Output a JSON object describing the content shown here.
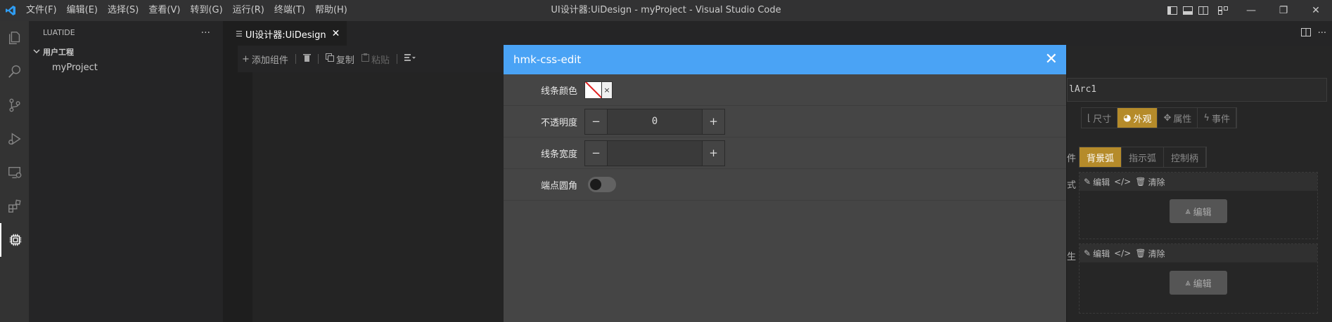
{
  "window": {
    "title": "UI设计器:UiDesign - myProject - Visual Studio Code",
    "menu": [
      "文件(F)",
      "编辑(E)",
      "选择(S)",
      "查看(V)",
      "转到(G)",
      "运行(R)",
      "终端(T)",
      "帮助(H)"
    ],
    "minimize": "—",
    "maximize": "❐",
    "close": "✕"
  },
  "sidebar": {
    "title": "LUATIDE",
    "more": "···",
    "section": "用户工程",
    "items": [
      {
        "label": "myProject"
      }
    ]
  },
  "editor": {
    "tab_label": "UI设计器:UiDesign",
    "tab_close": "✕",
    "more": "···"
  },
  "toolbar": {
    "add_label": "添加组件",
    "copy_label": "复制",
    "paste_label": "粘贴"
  },
  "modal": {
    "title": "hmk-css-edit",
    "close": "✕",
    "rows": {
      "line_color": "线条颜色",
      "opacity": "不透明度",
      "opacity_value": "0",
      "line_width": "线条宽度",
      "line_width_value": "",
      "round_ends": "端点圆角"
    },
    "round_ends_on": false,
    "swatch_clear": "×",
    "minus": "−",
    "plus": "+"
  },
  "right_panel": {
    "name_value": "lArc1",
    "tabs": [
      "尺寸",
      "外观",
      "属性",
      "事件"
    ],
    "active_tab": "外观",
    "side_label_1": "件",
    "side_label_2": "式",
    "side_label_3": "生",
    "subtabs": [
      "背景弧",
      "指示弧",
      "控制柄"
    ],
    "active_subtab": "背景弧",
    "block_edit": "编辑",
    "block_clear": "清除",
    "edit_button": "编辑"
  },
  "colors": {
    "accent": "#4aa3f5",
    "active_tab": "#b58b2a"
  }
}
